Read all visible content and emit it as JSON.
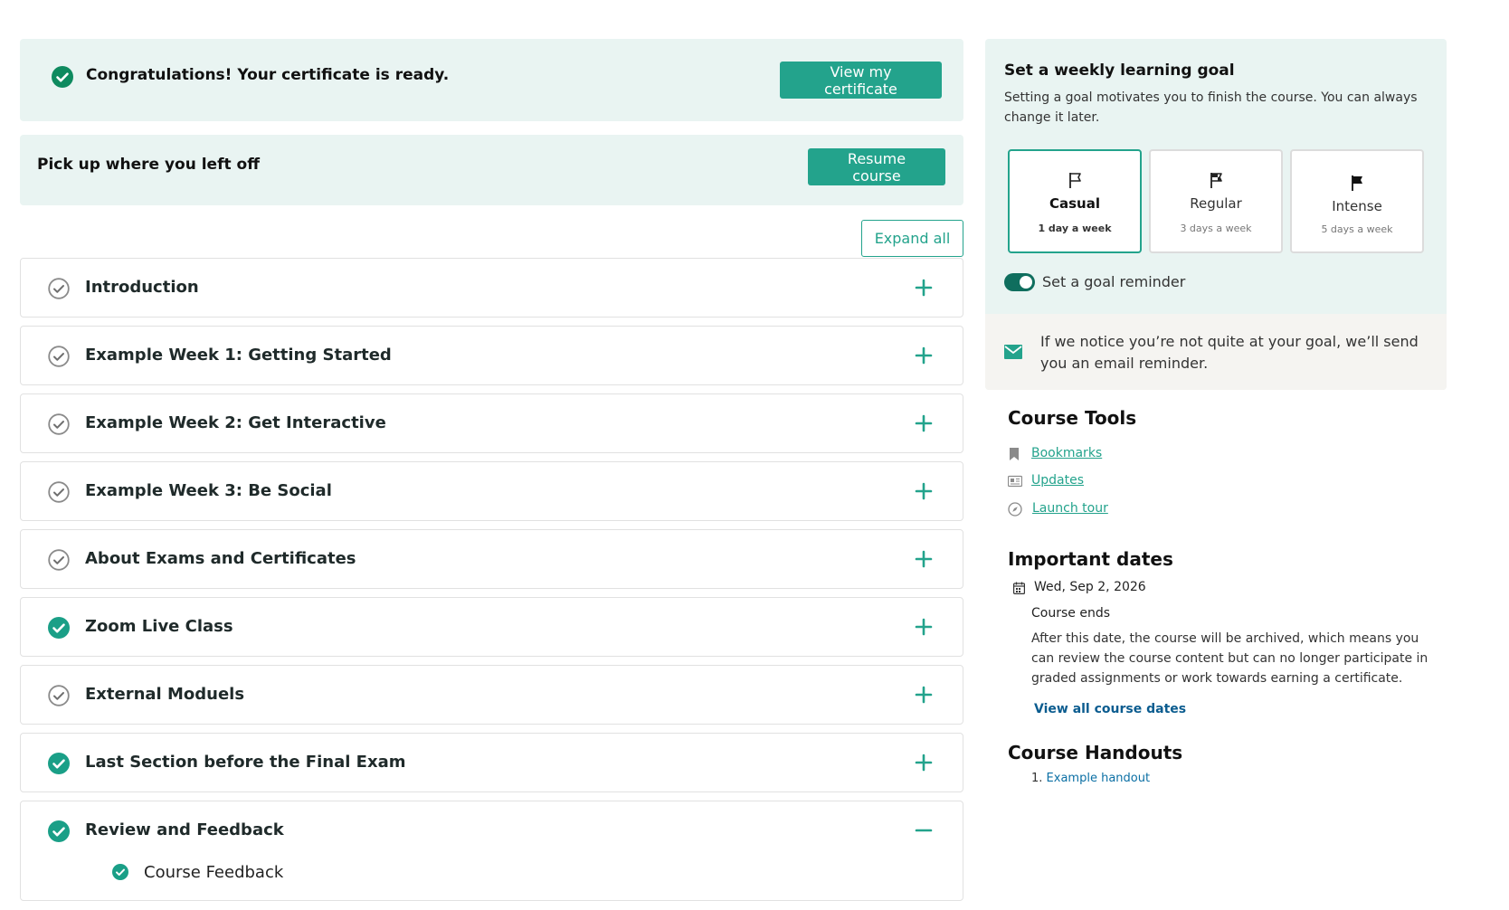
{
  "colors": {
    "accent": "#23a38c",
    "banner_bg": "#e9f4f2",
    "link_blue": "#0b5c8f",
    "toggle_on": "#0f6e5e"
  },
  "certificate": {
    "message": "Congratulations! Your certificate is ready.",
    "button": "View my certificate"
  },
  "resume": {
    "message": "Pick up where you left off",
    "button": "Resume course"
  },
  "expand_all": "Expand all",
  "sections": [
    {
      "title": "Introduction",
      "complete": false
    },
    {
      "title": "Example Week 1: Getting Started",
      "complete": false
    },
    {
      "title": "Example Week 2: Get Interactive",
      "complete": false
    },
    {
      "title": "Example Week 3: Be Social",
      "complete": false
    },
    {
      "title": "About Exams and Certificates",
      "complete": false
    },
    {
      "title": "Zoom Live Class",
      "complete": true
    },
    {
      "title": "External Moduels",
      "complete": false
    },
    {
      "title": "Last Section before the Final Exam",
      "complete": true
    },
    {
      "title": "Review and Feedback",
      "complete": true,
      "expanded": true,
      "items": [
        {
          "label": "Course Feedback",
          "complete": true
        }
      ]
    }
  ],
  "goal": {
    "title": "Set a weekly learning goal",
    "description": "Setting a goal motivates you to finish the course. You can always change it later.",
    "options": [
      {
        "label": "Casual",
        "sub": "1 day a week",
        "selected": true,
        "icon": "flag-outline-icon"
      },
      {
        "label": "Regular",
        "sub": "3 days a week",
        "selected": false,
        "icon": "flag-half-icon"
      },
      {
        "label": "Intense",
        "sub": "5 days a week",
        "selected": false,
        "icon": "flag-filled-icon"
      }
    ],
    "reminder_label": "Set a goal reminder",
    "reminder_on": true,
    "email_note": "If we notice you’re not quite at your goal, we’ll send you an email reminder."
  },
  "course_tools": {
    "title": "Course Tools",
    "items": [
      {
        "label": "Bookmarks",
        "icon": "bookmark-icon"
      },
      {
        "label": "Updates",
        "icon": "newspaper-icon"
      },
      {
        "label": "Launch tour",
        "icon": "compass-icon"
      }
    ]
  },
  "important_dates": {
    "title": "Important dates",
    "date": "Wed, Sep 2, 2026",
    "label": "Course ends",
    "description": "After this date, the course will be archived, which means you can review the course content but can no longer participate in graded assignments or work towards earning a certificate.",
    "view_all": "View all course dates"
  },
  "handouts": {
    "title": "Course Handouts",
    "number": "1.",
    "link": "Example handout"
  }
}
